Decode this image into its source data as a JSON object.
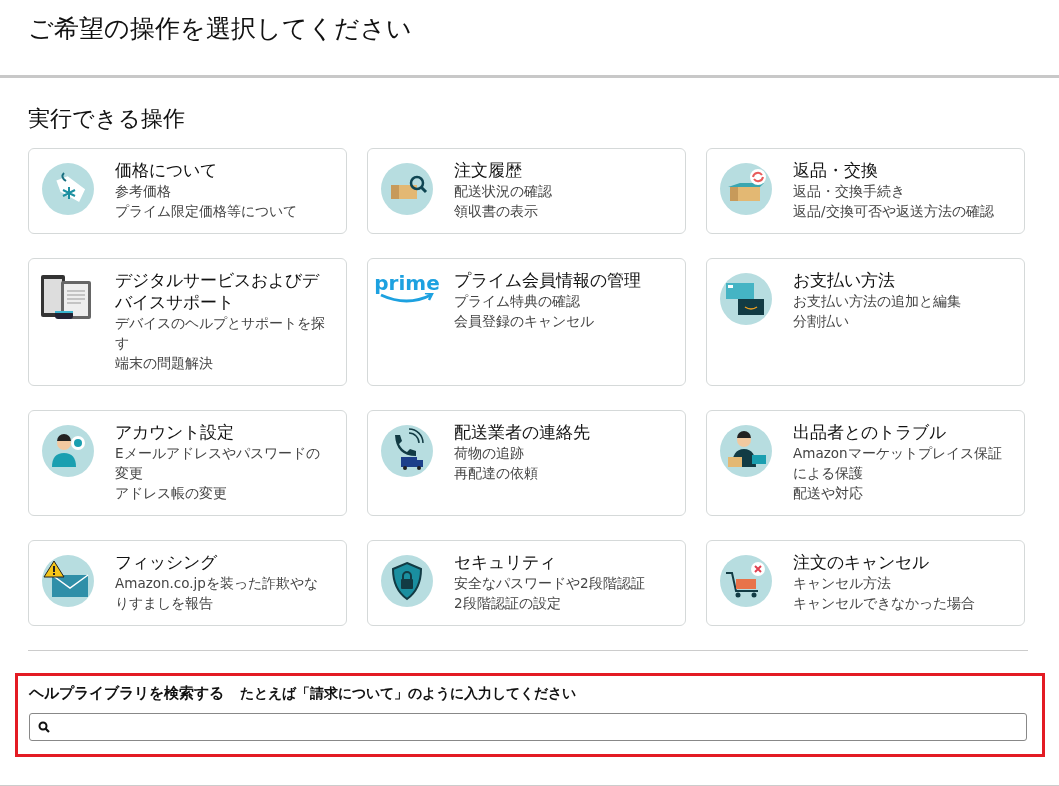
{
  "page_title": "ご希望の操作を選択してください",
  "section_title": "実行できる操作",
  "cards": [
    {
      "kind": "price-tag",
      "title": "価格について",
      "lines": [
        "参考価格",
        "プライム限定価格等について"
      ]
    },
    {
      "kind": "box-search",
      "title": "注文履歴",
      "lines": [
        "配送状況の確認",
        "領収書の表示"
      ]
    },
    {
      "kind": "box-return",
      "title": "返品・交換",
      "lines": [
        "返品・交換手続き",
        "返品/交換可否や返送方法の確認"
      ]
    },
    {
      "kind": "devices",
      "title": "デジタルサービスおよびデバイスサポート",
      "lines": [
        "デバイスのヘルプとサポートを探す",
        "端末の問題解決"
      ]
    },
    {
      "kind": "prime",
      "logo_text": "prime",
      "title": "プライム会員情報の管理",
      "lines": [
        "プライム特典の確認",
        "会員登録のキャンセル"
      ]
    },
    {
      "kind": "cards",
      "title": "お支払い方法",
      "lines": [
        "お支払い方法の追加と編集",
        "分割払い"
      ]
    },
    {
      "kind": "person-gear",
      "title": "アカウント設定",
      "lines": [
        "Eメールアドレスやパスワードの変更",
        "アドレス帳の変更"
      ]
    },
    {
      "kind": "phone-truck",
      "title": "配送業者の連絡先",
      "lines": [
        "荷物の追跡",
        "再配達の依頼"
      ]
    },
    {
      "kind": "seller",
      "title": "出品者とのトラブル",
      "lines": [
        "Amazonマーケットプレイス保証による保護",
        "配送や対応"
      ]
    },
    {
      "kind": "warning-mail",
      "title": "フィッシング",
      "lines": [
        "Amazon.co.jpを装った詐欺やなりすましを報告"
      ]
    },
    {
      "kind": "shield-lock",
      "title": "セキュリティ",
      "lines": [
        "安全なパスワードや2段階認証",
        "2段階認証の設定"
      ]
    },
    {
      "kind": "cart-x",
      "title": "注文のキャンセル",
      "lines": [
        "キャンセル方法",
        "キャンセルできなかった場合"
      ]
    }
  ],
  "search": {
    "label": "ヘルプライブラリを検索する",
    "hint": "たとえば「請求について」のように入力してください"
  }
}
